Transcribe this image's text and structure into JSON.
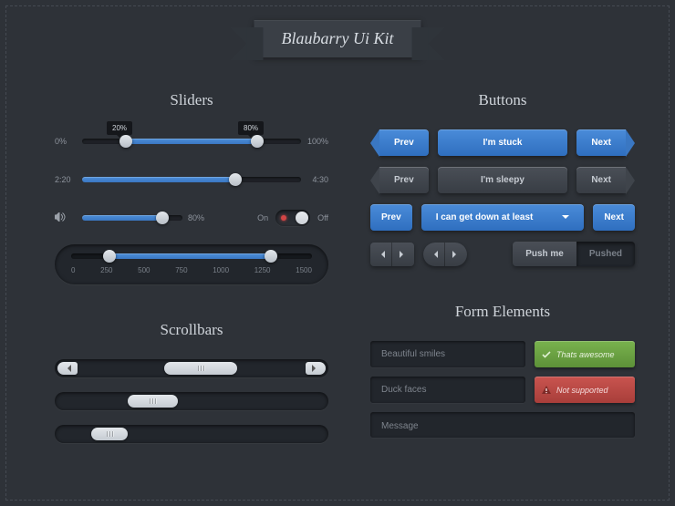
{
  "title": "Blaubarry Ui Kit",
  "sections": {
    "sliders": "Sliders",
    "buttons": "Buttons",
    "scrollbars": "Scrollbars",
    "form": "Form Elements"
  },
  "sliders": {
    "s1": {
      "left": "0%",
      "right": "100%",
      "tip1": "20%",
      "tip2": "80%"
    },
    "s2": {
      "left": "2:20",
      "right": "4:30"
    },
    "s3": {
      "value": "80%",
      "toggle_on": "On",
      "toggle_off": "Off"
    },
    "s4": {
      "ticks": [
        "0",
        "250",
        "500",
        "750",
        "1000",
        "1250",
        "1500"
      ]
    }
  },
  "buttons": {
    "row1": {
      "prev": "Prev",
      "mid": "I'm stuck",
      "next": "Next"
    },
    "row2": {
      "prev": "Prev",
      "mid": "I'm sleepy",
      "next": "Next"
    },
    "row3": {
      "prev": "Prev",
      "mid": "I can get down at least",
      "next": "Next"
    },
    "row4": {
      "push": "Push me",
      "pushed": "Pushed"
    }
  },
  "form": {
    "input1": "Beautiful smiles",
    "tag1": "Thats awesome",
    "input2": "Duck faces",
    "tag2": "Not supported",
    "message": "Message"
  }
}
